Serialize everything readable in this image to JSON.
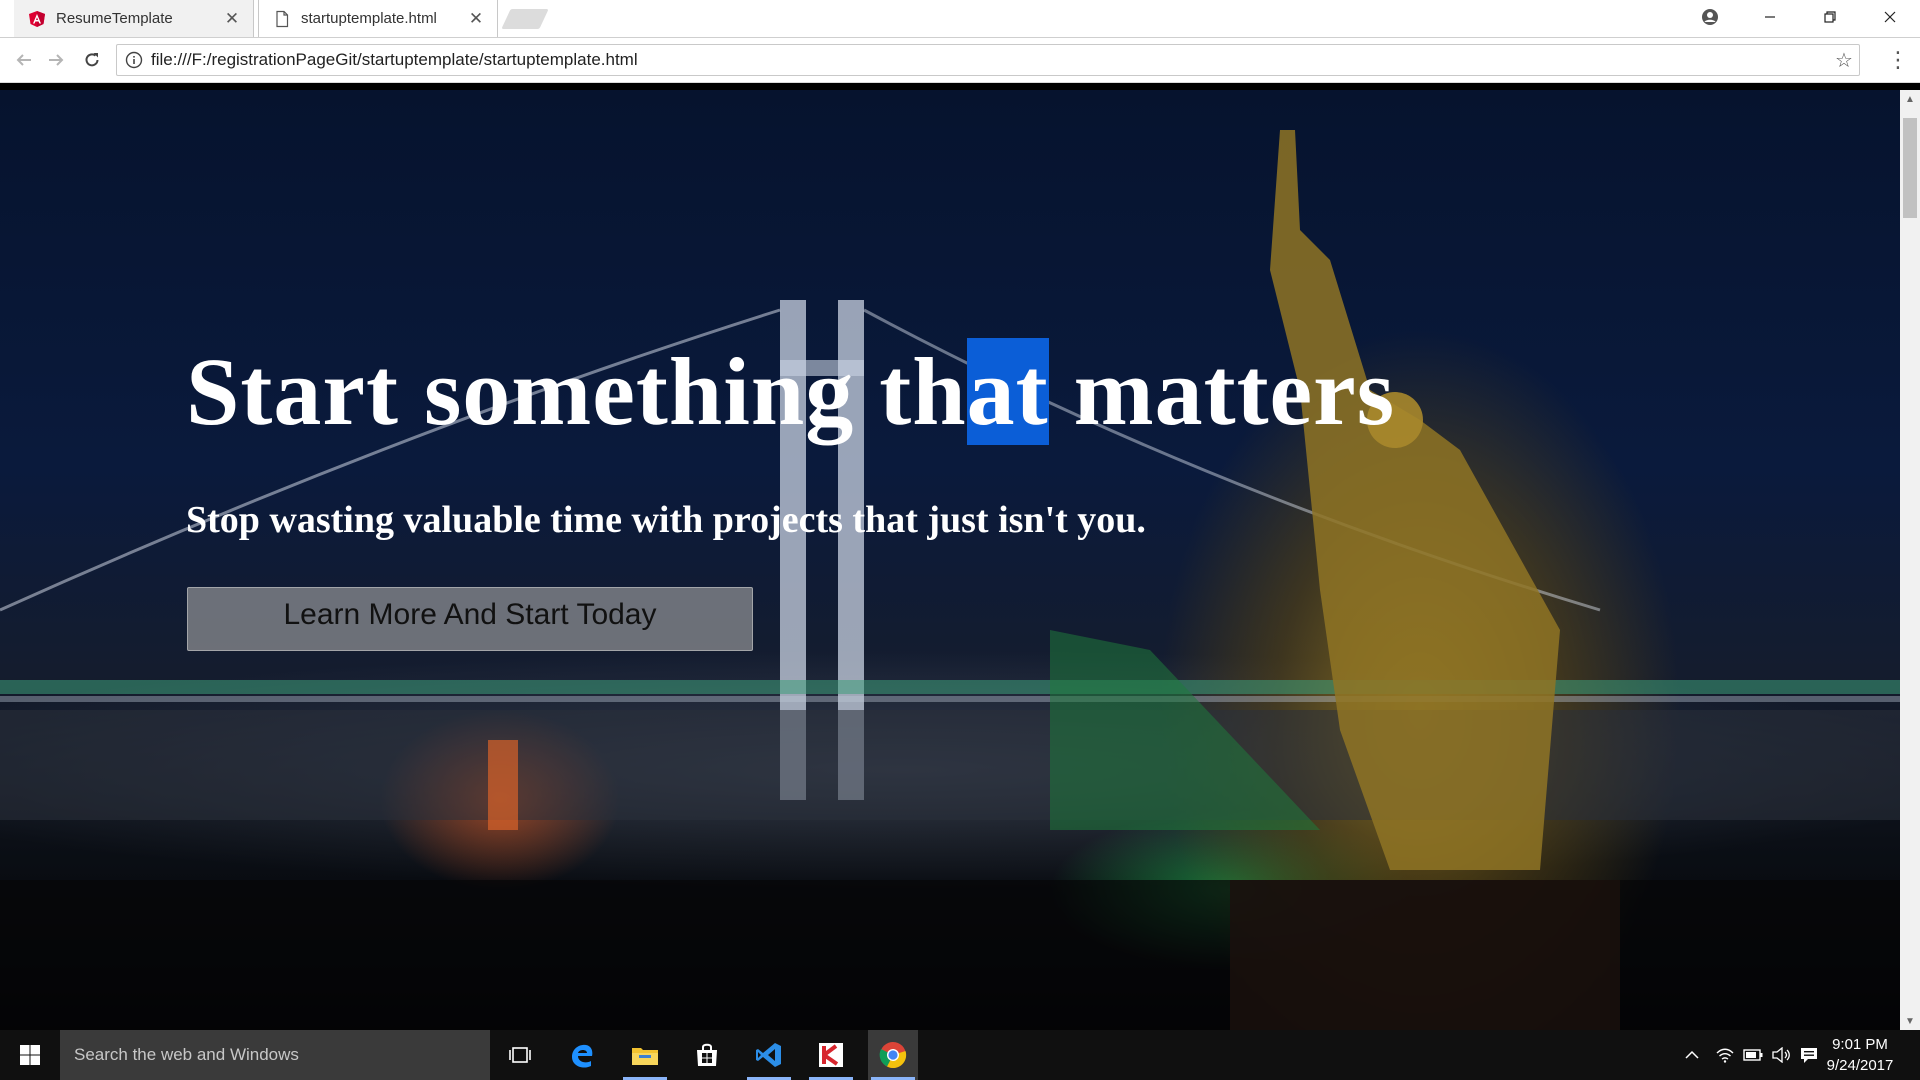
{
  "browser": {
    "tabs": [
      {
        "title": "ResumeTemplate",
        "active": false,
        "favicon": "angular-icon"
      },
      {
        "title": "startuptemplate.html",
        "active": true,
        "favicon": "file-icon"
      }
    ],
    "url": "file:///F:/registrationPageGit/startuptemplate/startuptemplate.html"
  },
  "page": {
    "title_before": "Start something th",
    "title_selected": "at",
    "title_after": " matters",
    "subtitle": "Stop wasting valuable time with projects that just isn't you.",
    "cta_label": "Learn More And Start Today"
  },
  "taskbar": {
    "search_placeholder": "Search the web and Windows",
    "time": "9:01 PM",
    "date": "9/24/2017",
    "pinned": [
      "task-view-icon",
      "edge-icon",
      "file-explorer-icon",
      "store-icon",
      "visual-studio-code-icon",
      "kaspersky-icon",
      "chrome-icon"
    ]
  },
  "colors": {
    "selection": "#0b5ed7",
    "taskbar": "#101010",
    "search_box": "#3a3a3a"
  }
}
